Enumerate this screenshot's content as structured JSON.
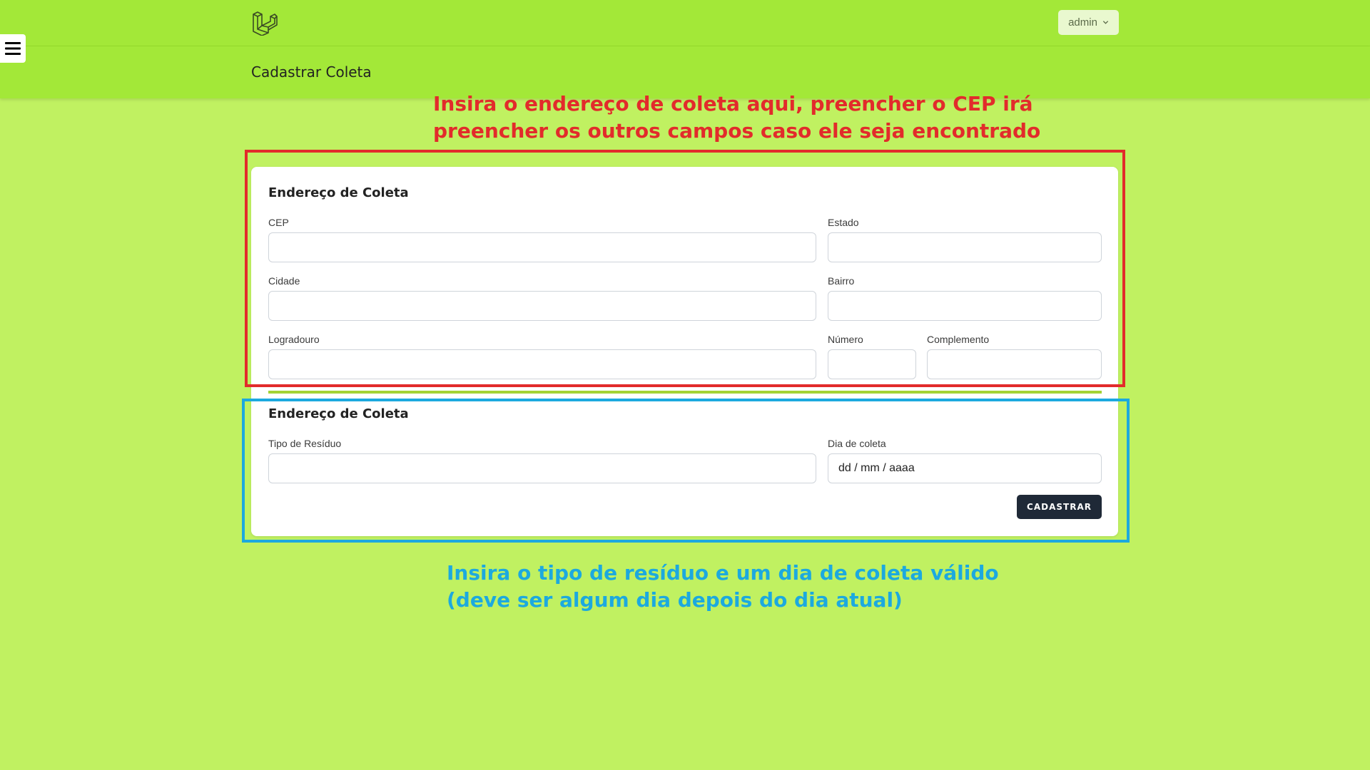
{
  "nav": {
    "logo_icon": "laravel-logo-icon",
    "user_menu_label": "admin",
    "user_menu_icon": "chevron-down-icon"
  },
  "header": {
    "title": "Cadastrar Coleta"
  },
  "sidebar_toggle": {
    "icon": "hamburger-menu-icon"
  },
  "annotations": {
    "address_note": "Insira o endereço de coleta aqui, preencher o CEP irá\npreencher os outros campos caso ele seja encontrado",
    "residue_note": "Insira o tipo de resíduo e um dia de coleta válido\n(deve ser algum dia depois do dia atual)",
    "address_color": "#e22b2b",
    "residue_color": "#1ca9df"
  },
  "form": {
    "address_section": {
      "title": "Endereço de Coleta",
      "fields": {
        "cep": {
          "label": "CEP",
          "value": ""
        },
        "estado": {
          "label": "Estado",
          "value": ""
        },
        "cidade": {
          "label": "Cidade",
          "value": ""
        },
        "bairro": {
          "label": "Bairro",
          "value": ""
        },
        "logradouro": {
          "label": "Logradouro",
          "value": ""
        },
        "numero": {
          "label": "Número",
          "value": ""
        },
        "complemento": {
          "label": "Complemento",
          "value": ""
        }
      }
    },
    "collection_section": {
      "title": "Endereço de Coleta",
      "fields": {
        "tipo_residuo": {
          "label": "Tipo de Resíduo",
          "value": ""
        },
        "dia_coleta": {
          "label": "Dia de coleta",
          "placeholder": "dd / mm / aaaa",
          "value": ""
        }
      }
    },
    "submit_label": "CADASTRAR"
  },
  "colors": {
    "page_background": "#c0f161",
    "nav_background": "#a3e838",
    "submit_button": "#1f2937"
  }
}
